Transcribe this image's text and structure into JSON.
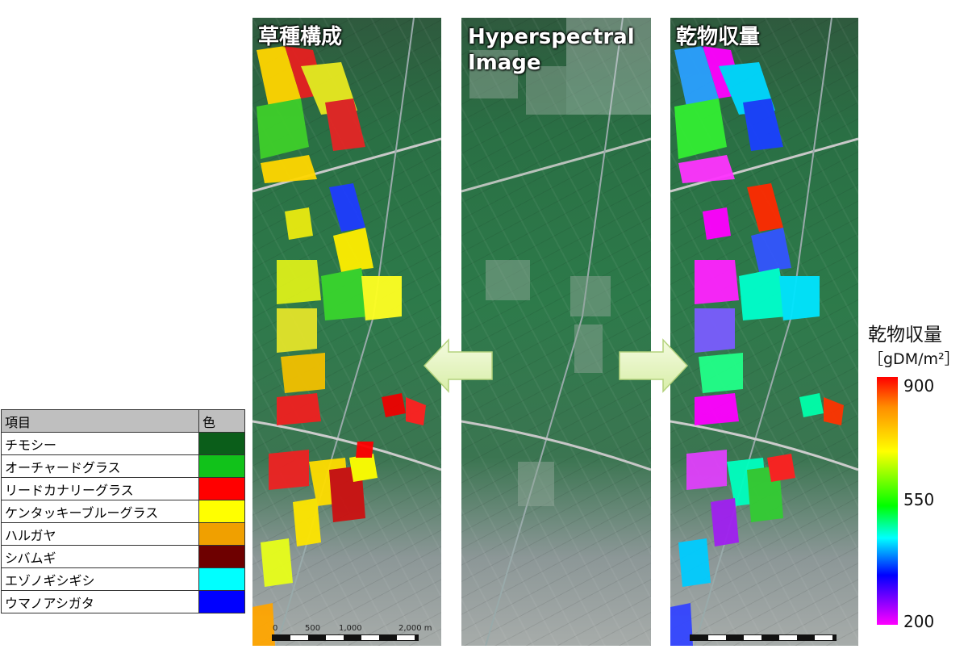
{
  "panels": {
    "composition_title": "草種構成",
    "hyperspectral_title_line1": "Hyperspectral",
    "hyperspectral_title_line2": "Image",
    "yield_title": "乾物収量"
  },
  "legend": {
    "header_item": "項目",
    "header_color": "色",
    "rows": [
      {
        "name": "チモシー",
        "color": "#0b5e1a"
      },
      {
        "name": "オーチャードグラス",
        "color": "#11c21a"
      },
      {
        "name": "リードカナリーグラス",
        "color": "#ff0000"
      },
      {
        "name": "ケンタッキーブルーグラス",
        "color": "#ffff00"
      },
      {
        "name": "ハルガヤ",
        "color": "#f0a000"
      },
      {
        "name": "シバムギ",
        "color": "#6e0000"
      },
      {
        "name": "エゾノギシギシ",
        "color": "#00ffff"
      },
      {
        "name": "ウマノアシガタ",
        "color": "#0000ff"
      }
    ]
  },
  "colorbar": {
    "title": "乾物収量",
    "unit": "［gDM/m²］",
    "max_label": "900",
    "mid_label": "550",
    "min_label": "200"
  },
  "scale": {
    "labels": [
      "0",
      "500",
      "1,000",
      "2,000 m"
    ]
  }
}
